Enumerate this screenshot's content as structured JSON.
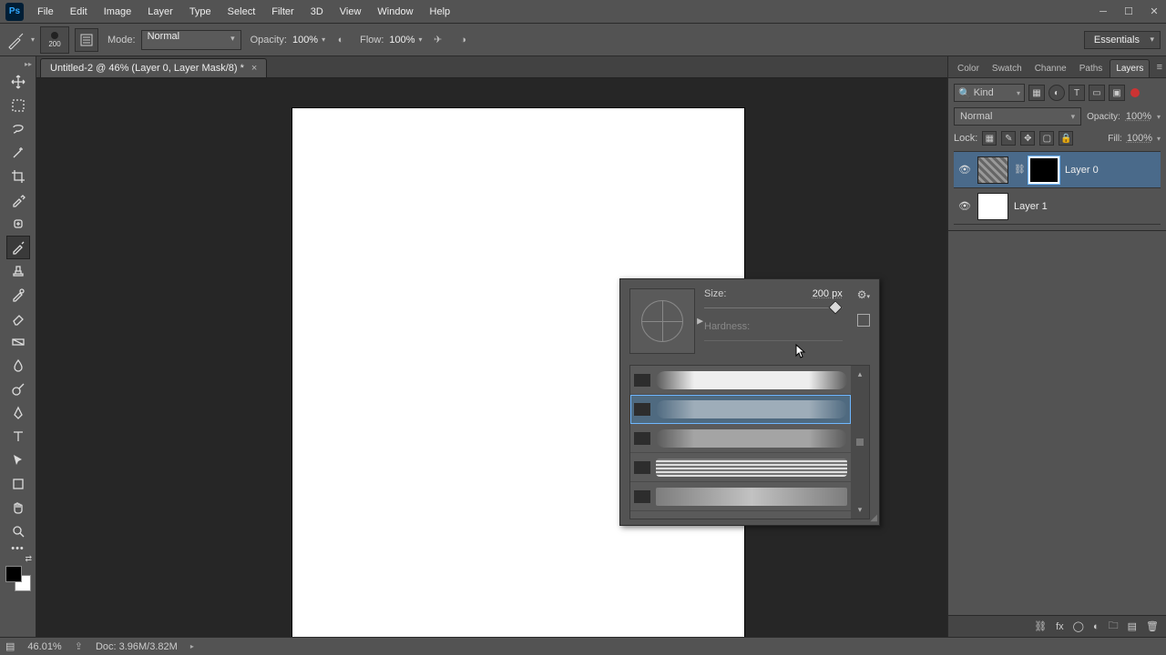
{
  "menu": {
    "file": "File",
    "edit": "Edit",
    "image": "Image",
    "layer": "Layer",
    "type": "Type",
    "select": "Select",
    "filter": "Filter",
    "threeD": "3D",
    "view": "View",
    "window": "Window",
    "help": "Help"
  },
  "options": {
    "brush_size": "200",
    "mode_label": "Mode:",
    "mode_value": "Normal",
    "opacity_label": "Opacity:",
    "opacity_value": "100%",
    "flow_label": "Flow:",
    "flow_value": "100%",
    "workspace": "Essentials"
  },
  "document": {
    "tab_title": "Untitled-2 @ 46% (Layer 0, Layer Mask/8) *"
  },
  "brush_popup": {
    "size_label": "Size:",
    "size_value": "200 px",
    "hardness_label": "Hardness:"
  },
  "panel_tabs": {
    "color": "Color",
    "swatches": "Swatch",
    "channels": "Channe",
    "paths": "Paths",
    "layers": "Layers"
  },
  "layers": {
    "filter_kind": "Kind",
    "blend_mode": "Normal",
    "opacity_label": "Opacity:",
    "opacity_value": "100%",
    "lock_label": "Lock:",
    "fill_label": "Fill:",
    "fill_value": "100%",
    "items": [
      {
        "name": "Layer 0"
      },
      {
        "name": "Layer 1"
      }
    ]
  },
  "status": {
    "zoom": "46.01%",
    "doc": "Doc: 3.96M/3.82M"
  }
}
